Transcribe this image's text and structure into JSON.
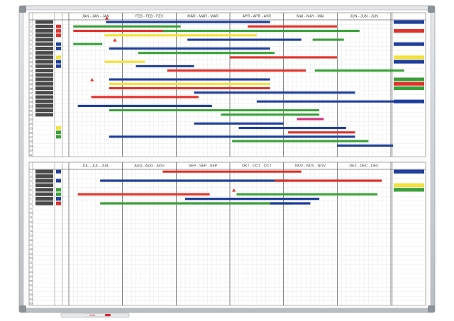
{
  "board": {
    "frame_color": "#c9cdd1",
    "surface_color": "#fbfbfb",
    "grid_color": "#d9d9d9"
  },
  "colors": {
    "blue": "#1f3f9c",
    "green": "#3aa03a",
    "red": "#e0312a",
    "yellow": "#f4e234",
    "magenta": "#d62f7a",
    "label": "#4a4a4a"
  },
  "panels": [
    {
      "months": [
        "JAN - JAN - JAN",
        "FEB - FEB - FEV",
        "MÄR - MAR - MAR",
        "APR - APR - AVR",
        "MAI - MAY - MAI",
        "JUN - JUN - JUN"
      ],
      "rows": 31,
      "label_rows": 22,
      "left_tags": [
        null,
        "red",
        "red",
        "red",
        null,
        "blue",
        "blue",
        null,
        "yellow",
        "blue",
        "blue",
        null,
        null,
        null,
        null,
        null,
        null,
        null,
        null,
        null,
        null,
        null,
        null,
        null,
        "yellow",
        "green",
        "green"
      ],
      "right_tags": [
        "blue",
        null,
        "red",
        null,
        null,
        "blue",
        null,
        null,
        "yellow",
        "blue",
        null,
        null,
        null,
        "green",
        "red",
        "green",
        null,
        null,
        "blue"
      ],
      "bars": [
        {
          "row": 0,
          "start": 8.3,
          "end": 45,
          "color": "blue"
        },
        {
          "row": 1,
          "start": 1,
          "end": 25,
          "color": "green"
        },
        {
          "row": 1,
          "start": 40,
          "end": 60,
          "color": "red"
        },
        {
          "row": 2,
          "start": 1,
          "end": 22,
          "color": "red"
        },
        {
          "row": 2,
          "start": 21,
          "end": 65,
          "color": "green"
        },
        {
          "row": 3,
          "start": 8,
          "end": 42,
          "color": "yellow"
        },
        {
          "row": 4,
          "start": 26.5,
          "end": 52,
          "color": "blue"
        },
        {
          "row": 4,
          "start": 54.5,
          "end": 61.5,
          "color": "green"
        },
        {
          "row": 5,
          "start": 1,
          "end": 7.5,
          "color": "green"
        },
        {
          "row": 6,
          "start": 9,
          "end": 45,
          "color": "blue"
        },
        {
          "row": 7,
          "start": 15.5,
          "end": 46,
          "color": "green"
        },
        {
          "row": 8,
          "start": 36,
          "end": 60,
          "color": "red"
        },
        {
          "row": 9,
          "start": 8,
          "end": 17,
          "color": "yellow"
        },
        {
          "row": 10,
          "start": 15,
          "end": 28,
          "color": "blue"
        },
        {
          "row": 11,
          "start": 22,
          "end": 53,
          "color": "red"
        },
        {
          "row": 11,
          "start": 55,
          "end": 75,
          "color": "green"
        },
        {
          "row": 13,
          "start": 9,
          "end": 45,
          "color": "blue"
        },
        {
          "row": 14,
          "start": 9,
          "end": 45,
          "color": "yellow"
        },
        {
          "row": 15,
          "start": 9,
          "end": 45,
          "color": "red"
        },
        {
          "row": 16,
          "start": 28,
          "end": 64,
          "color": "blue"
        },
        {
          "row": 17,
          "start": 5,
          "end": 29,
          "color": "red"
        },
        {
          "row": 18,
          "start": 42,
          "end": 75,
          "color": "blue"
        },
        {
          "row": 19,
          "start": 2,
          "end": 32,
          "color": "blue"
        },
        {
          "row": 20,
          "start": 9,
          "end": 56,
          "color": "green"
        },
        {
          "row": 21,
          "start": 34,
          "end": 56,
          "color": "green"
        },
        {
          "row": 22,
          "start": 51,
          "end": 57,
          "color": "magenta"
        },
        {
          "row": 23,
          "start": 28,
          "end": 48,
          "color": "blue"
        },
        {
          "row": 24,
          "start": 38,
          "end": 62,
          "color": "blue"
        },
        {
          "row": 25,
          "start": 49,
          "end": 64,
          "color": "red"
        },
        {
          "row": 26,
          "start": 9,
          "end": 64,
          "color": "blue"
        },
        {
          "row": 27,
          "start": 36.5,
          "end": 67,
          "color": "green"
        },
        {
          "row": 28,
          "start": 60,
          "end": 72.5,
          "color": "blue"
        }
      ],
      "markers": [
        {
          "row": 0,
          "pos": 8.5
        },
        {
          "row": 5,
          "pos": 10.3
        },
        {
          "row": 14,
          "pos": 5.2
        }
      ]
    },
    {
      "months": [
        "JUL - JUL - JUIL",
        "AUG - AUG - AOU",
        "SEP - SEP - SEP",
        "OKT - OCT - OCT",
        "NOV - NOV - NOV",
        "DEZ - DEC - DEC"
      ],
      "rows": 30,
      "label_rows": 8,
      "left_tags": [
        "blue",
        null,
        "blue",
        null,
        "green",
        "green",
        "blue",
        "red"
      ],
      "right_tags": [
        "blue",
        null,
        null,
        "yellow",
        "green"
      ],
      "bars": [
        {
          "row": 0,
          "start": 21,
          "end": 52,
          "color": "red"
        },
        {
          "row": 2,
          "start": 7,
          "end": 49,
          "color": "blue"
        },
        {
          "row": 2,
          "start": 46,
          "end": 70,
          "color": "red"
        },
        {
          "row": 5,
          "start": 2,
          "end": 31.5,
          "color": "red"
        },
        {
          "row": 5,
          "start": 37.5,
          "end": 69,
          "color": "green"
        },
        {
          "row": 6,
          "start": 26,
          "end": 56,
          "color": "blue"
        },
        {
          "row": 7,
          "start": 7,
          "end": 50,
          "color": "green"
        },
        {
          "row": 7,
          "start": 45,
          "end": 54,
          "color": "blue"
        }
      ],
      "markers": [
        {
          "row": 5,
          "pos": 36.9
        }
      ]
    }
  ],
  "tray": {
    "lettering": "MAUL"
  }
}
